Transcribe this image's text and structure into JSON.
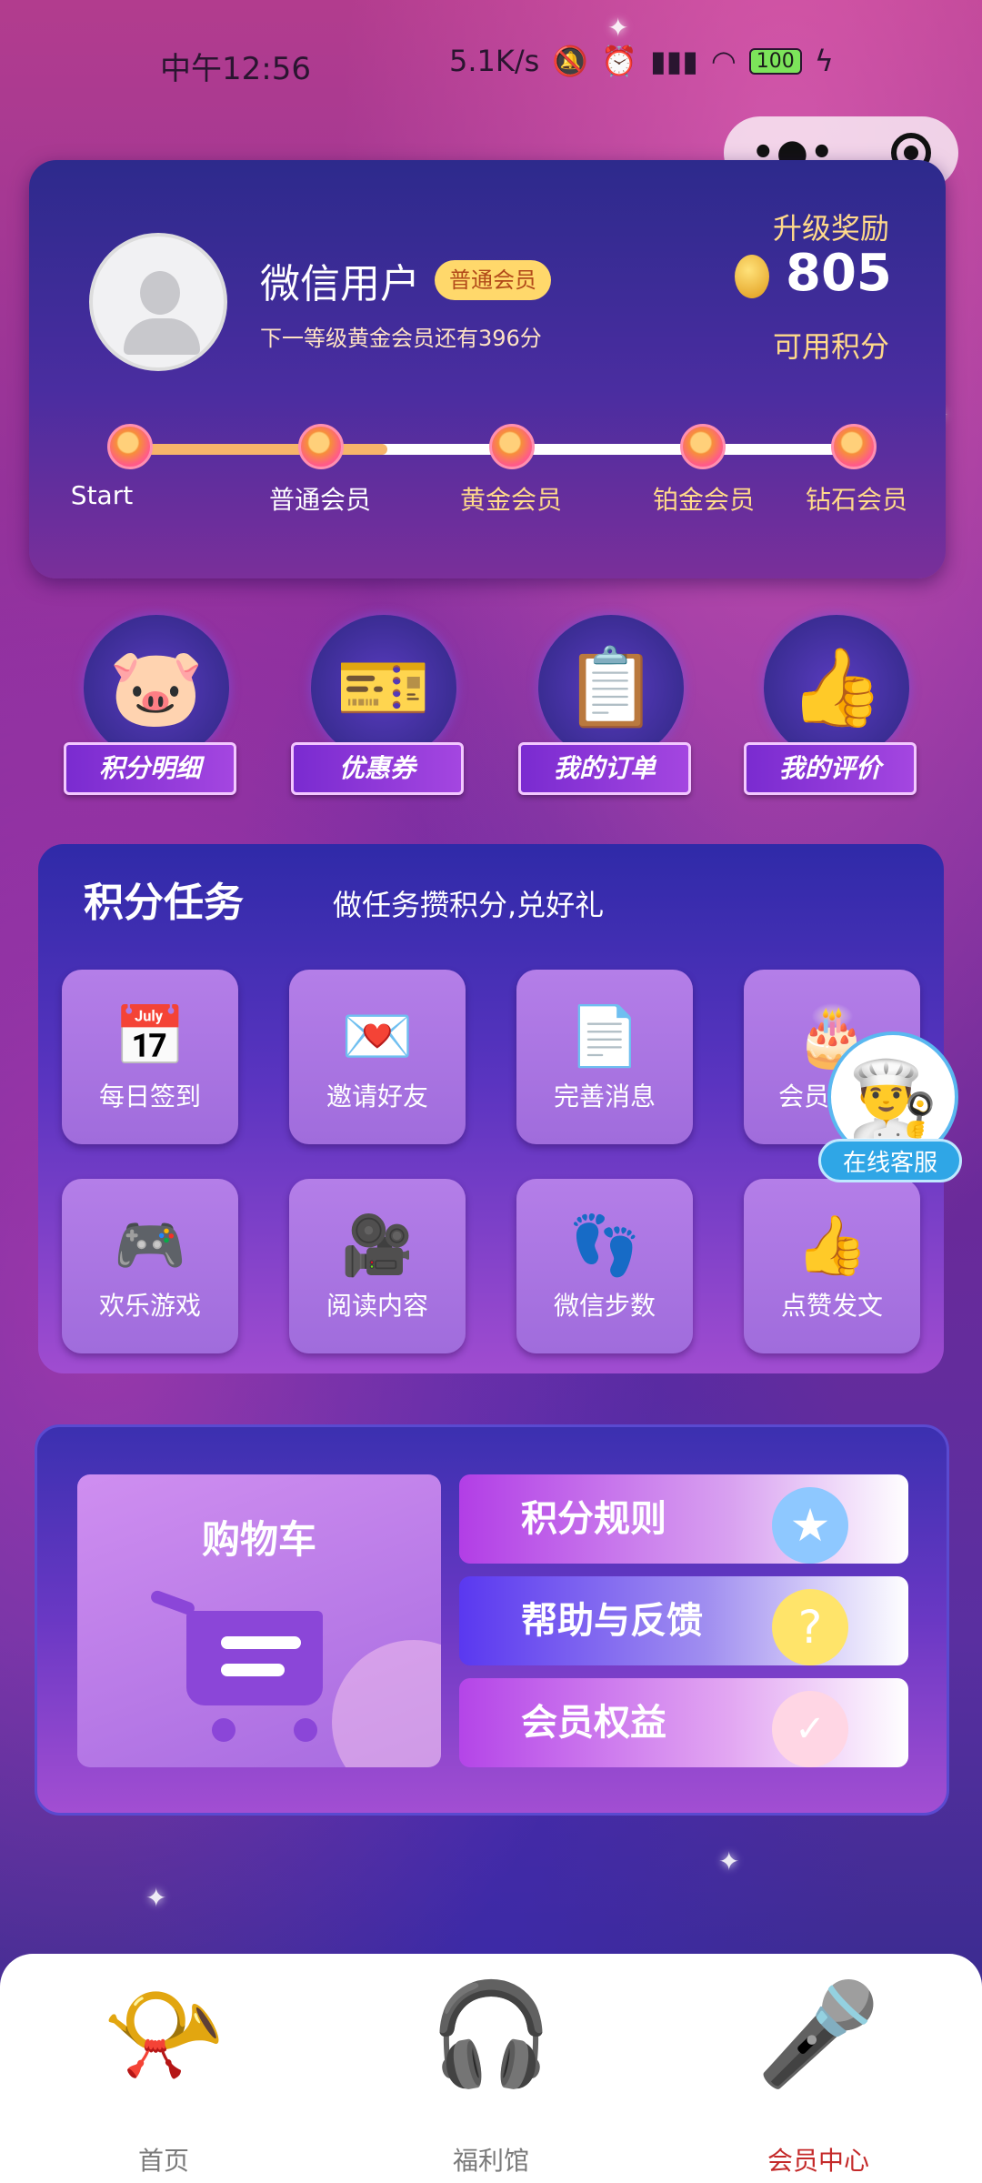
{
  "status_bar": {
    "time": "中午12:56",
    "net_speed": "5.1K/s",
    "battery": "100"
  },
  "capsule": {
    "more_icon": "more-dots-icon",
    "close_icon": "target-icon"
  },
  "profile": {
    "username": "微信用户",
    "member_badge": "普通会员",
    "next_level_text": "下一等级黄金会员还有396分",
    "reward_title": "升级奖励",
    "points": "805",
    "points_label": "可用积分",
    "levels": [
      "Start",
      "普通会员",
      "黄金会员",
      "铂金会员",
      "钻石会员"
    ],
    "progress_fraction": 0.36
  },
  "quick_actions": [
    {
      "label": "积分明细",
      "icon": "piggy-bank-icon"
    },
    {
      "label": "优惠券",
      "icon": "coupon-icon"
    },
    {
      "label": "我的订单",
      "icon": "order-book-icon"
    },
    {
      "label": "我的评价",
      "icon": "thumbs-up-stars-icon"
    }
  ],
  "tasks": {
    "title": "积分任务",
    "subtitle": "做任务攒积分,兑好礼",
    "items": [
      {
        "label": "每日签到",
        "icon": "calendar-check-icon"
      },
      {
        "label": "邀请好友",
        "icon": "heart-envelope-icon"
      },
      {
        "label": "完善消息",
        "icon": "document-icon"
      },
      {
        "label": "会员",
        "icon": "birthday-cake-icon"
      },
      {
        "label": "欢乐游戏",
        "icon": "gamepad-icon"
      },
      {
        "label": "阅读内容",
        "icon": "video-camera-icon"
      },
      {
        "label": "微信步数",
        "icon": "footprint-icon"
      },
      {
        "label": "点赞发文",
        "icon": "thumbs-up-icon"
      }
    ]
  },
  "customer_service": {
    "label": "在线客服",
    "icon": "chef-avatar-icon"
  },
  "shortcuts": {
    "cart_title": "购物车",
    "rules": "积分规则",
    "help": "帮助与反馈",
    "benefits": "会员权益",
    "help_glyph": "?",
    "benefit_glyph": "✓"
  },
  "tab_bar": [
    {
      "label": "首页",
      "icon": "gramophone-icon",
      "active": false
    },
    {
      "label": "福利馆",
      "icon": "headphones-icon",
      "active": false
    },
    {
      "label": "会员中心",
      "icon": "microphone-icon",
      "active": true
    }
  ]
}
